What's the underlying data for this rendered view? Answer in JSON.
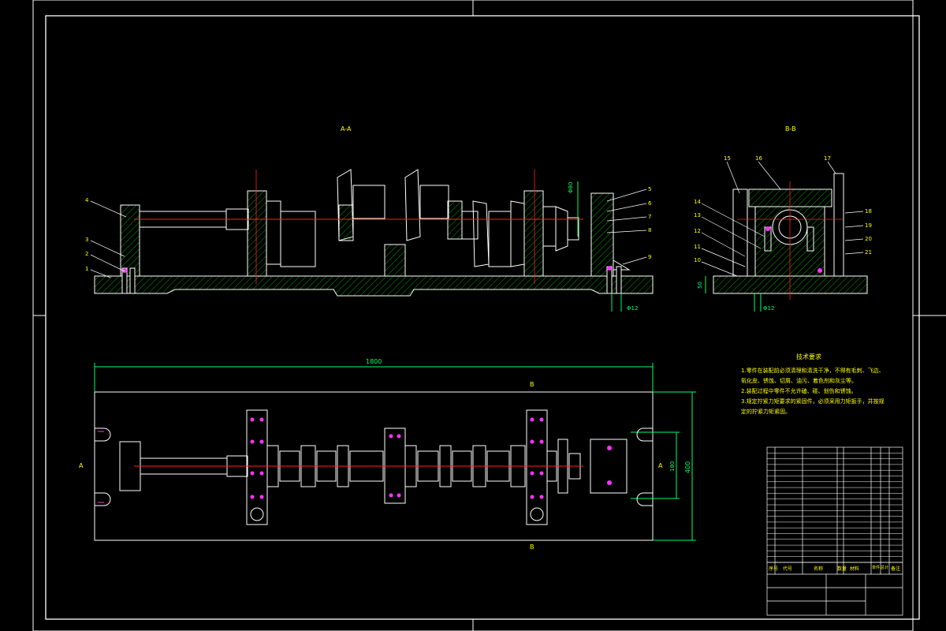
{
  "colors": {
    "background": "#000000",
    "outline": "#ffffff",
    "hatch": "#00a000",
    "centerline": "#ff2020",
    "dimension": "#00ff66",
    "text": "#ffff00",
    "highlight": "#ff33ff"
  },
  "views": {
    "section_aa": "A-A",
    "section_bb": "B-B"
  },
  "dimensions": {
    "overall_length": "1800",
    "width": "400",
    "inner_width": "180",
    "height": "50",
    "dia_left": "Φ12",
    "dia_right": "Φ12",
    "dia_vertical": "Φ80"
  },
  "section_marks": {
    "a_left": "A",
    "a_right": "A",
    "b_top": "B",
    "b_bottom": "B"
  },
  "callouts_left": [
    "1",
    "2",
    "3",
    "4"
  ],
  "callouts_right": [
    "5",
    "6",
    "7",
    "8",
    "9"
  ],
  "callouts_bb_left": [
    "15",
    "14",
    "13",
    "12",
    "11",
    "10"
  ],
  "callouts_bb_top": [
    "16",
    "17"
  ],
  "callouts_bb_right": [
    "18",
    "19",
    "20",
    "21"
  ],
  "tech_req": {
    "title": "技术要求",
    "lines": [
      "1.零件在装配前必须清理和清洗干净，不得有毛刺、飞边、",
      "氧化皮、锈蚀、切屑、油污、着色剂和灰尘等。",
      "2.装配过程中零件不允许磕、碰、划伤和锈蚀。",
      "3.规定拧紧力矩要求的紧固件，必须采用力矩扳手，并按规",
      "定的拧紧力矩紧固。"
    ]
  },
  "title_block": {
    "header": [
      "序号",
      "代号",
      "名称",
      "数量",
      "材料",
      "单件",
      "总计",
      "备注"
    ]
  }
}
